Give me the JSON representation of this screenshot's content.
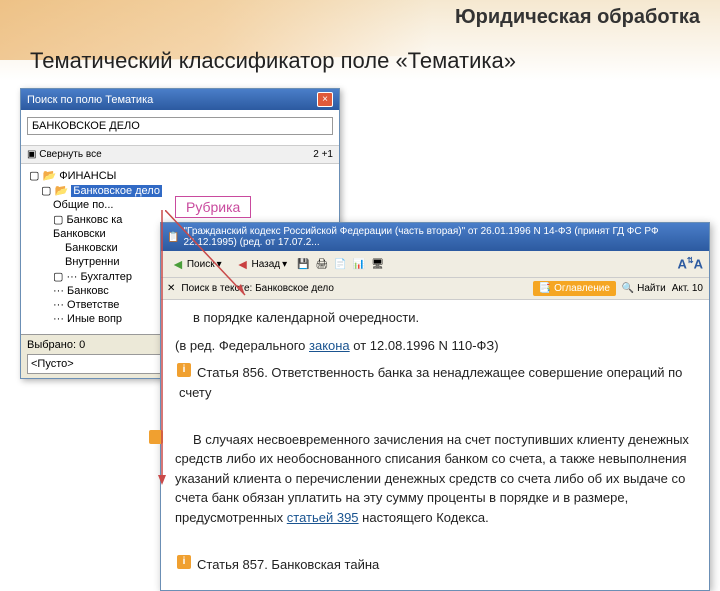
{
  "header": "Юридическая обработка",
  "subtitle": "Тематический классификатор поле «Тематика»",
  "annotation": "Рубрика",
  "search": {
    "title": "Поиск по полю Тематика",
    "input_value": "БАНКОВСКОЕ ДЕЛО",
    "collapse": "Свернуть все",
    "count": "2 +1",
    "tree": {
      "root": "ФИНАНСЫ",
      "selected": "Банковское дело",
      "items": [
        "Общие по...",
        "Банковс ка",
        "Банковски",
        "Банковски",
        "Внутренни",
        "Бухгалтер",
        "Банковс",
        "Ответстве",
        "Иные вопр"
      ]
    },
    "selected_label": "Выбрано: 0",
    "empty": "<Пусто>"
  },
  "doc": {
    "title": "\"Гражданский кодекс Российской Федерации (часть вторая)\" от 26.01.1996 N 14-ФЗ (принят ГД ФС РФ 22.12.1995) (ред. от 17.07.2...",
    "nav_back": "Поиск",
    "nav_fwd": "Назад",
    "breadcrumb": "Поиск в тексте: Банковское дело",
    "badge": "Оглавление",
    "find_label": "Найти",
    "art_badge": "Акт. 10",
    "p1": "в порядке календарной очередности.",
    "p2_a": "(в ред. Федерального ",
    "p2_link": "закона",
    "p2_b": " от 12.08.1996 N 110-ФЗ)",
    "art856": "Статья 856. Ответственность банка за ненадлежащее совершение операций по счету",
    "p3_a": "В случаях несвоевременного зачисления на счет поступивших клиенту денежных средств либо их необоснованного списания банком со счета, а также невыполнения указаний клиента о перечислении денежных средств со счета либо об их выдаче со счета банк обязан уплатить на эту сумму проценты в порядке и в размере, предусмотренных ",
    "p3_link": "статьей 395",
    "p3_b": " настоящего Кодекса.",
    "art857": "Статья 857. Банковская тайна"
  }
}
